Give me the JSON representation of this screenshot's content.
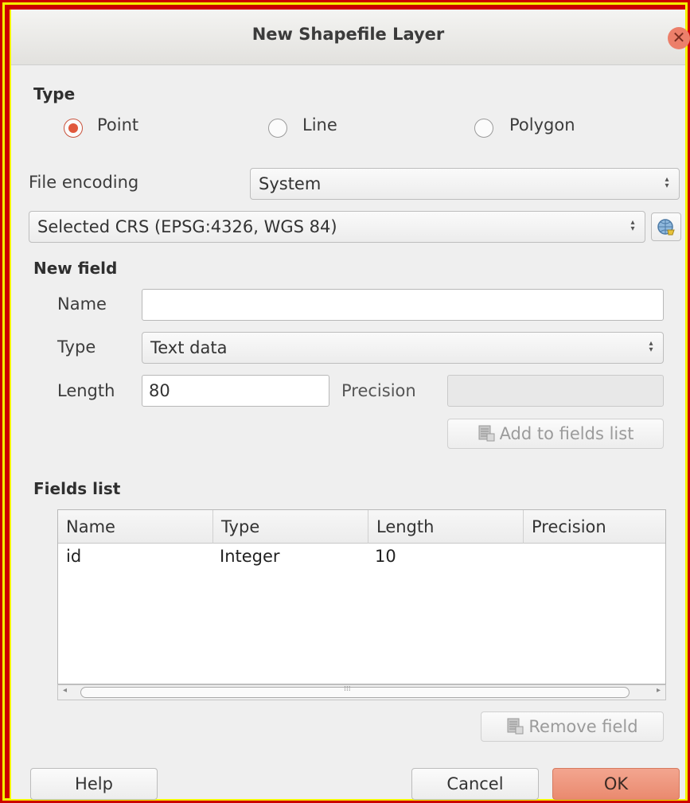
{
  "window": {
    "title": "New Shapefile Layer",
    "close_glyph": "✕"
  },
  "type_section": {
    "label": "Type",
    "options": [
      {
        "label": "Point",
        "checked": true
      },
      {
        "label": "Line",
        "checked": false
      },
      {
        "label": "Polygon",
        "checked": false
      }
    ]
  },
  "encoding": {
    "label": "File encoding",
    "value": "System"
  },
  "crs": {
    "value": "Selected CRS (EPSG:4326, WGS 84)"
  },
  "new_field": {
    "label": "New field",
    "name_label": "Name",
    "name_value": "",
    "type_label": "Type",
    "type_value": "Text data",
    "length_label": "Length",
    "length_value": "80",
    "precision_label": "Precision",
    "precision_value": "",
    "add_button": "Add to fields list"
  },
  "fields_list": {
    "label": "Fields list",
    "columns": [
      "Name",
      "Type",
      "Length",
      "Precision"
    ],
    "rows": [
      {
        "name": "id",
        "type": "Integer",
        "length": "10",
        "precision": ""
      }
    ],
    "scroll_center": "⁞⁞⁞",
    "remove_button": "Remove field"
  },
  "buttons": {
    "help": "Help",
    "cancel": "Cancel",
    "ok": "OK"
  },
  "colors": {
    "accent": "#e0583c",
    "ok_button": "#ea8a6f",
    "frame_red": "#cc0000",
    "frame_yellow": "#f5f500"
  }
}
